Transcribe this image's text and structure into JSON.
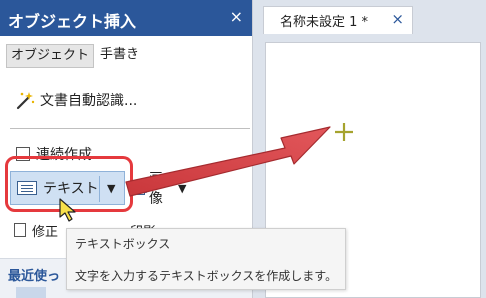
{
  "panel": {
    "title": "オブジェクト挿入",
    "close_label": "×",
    "tabs": [
      {
        "label": "オブジェクト",
        "active": true
      },
      {
        "label": "手書き",
        "active": false
      }
    ],
    "autodetect_label": "文書自動認識...",
    "continuous_label": "連続作成",
    "text_button_label": "テキスト",
    "image_button_label": "画像",
    "row2_left_label": "修正",
    "row2_right_label": "印影",
    "recent_label": "最近使っ"
  },
  "document": {
    "tab_title": "名称未設定 1 *",
    "tab_close_label": "×"
  },
  "tooltip": {
    "title": "テキストボックス",
    "description": "文字を入力するテキストボックスを作成します。"
  },
  "colors": {
    "header_bg": "#2b579a",
    "highlight_border": "#e5393d",
    "arrow_fill": "#d9474b",
    "crosshair": "#a6a32e"
  }
}
